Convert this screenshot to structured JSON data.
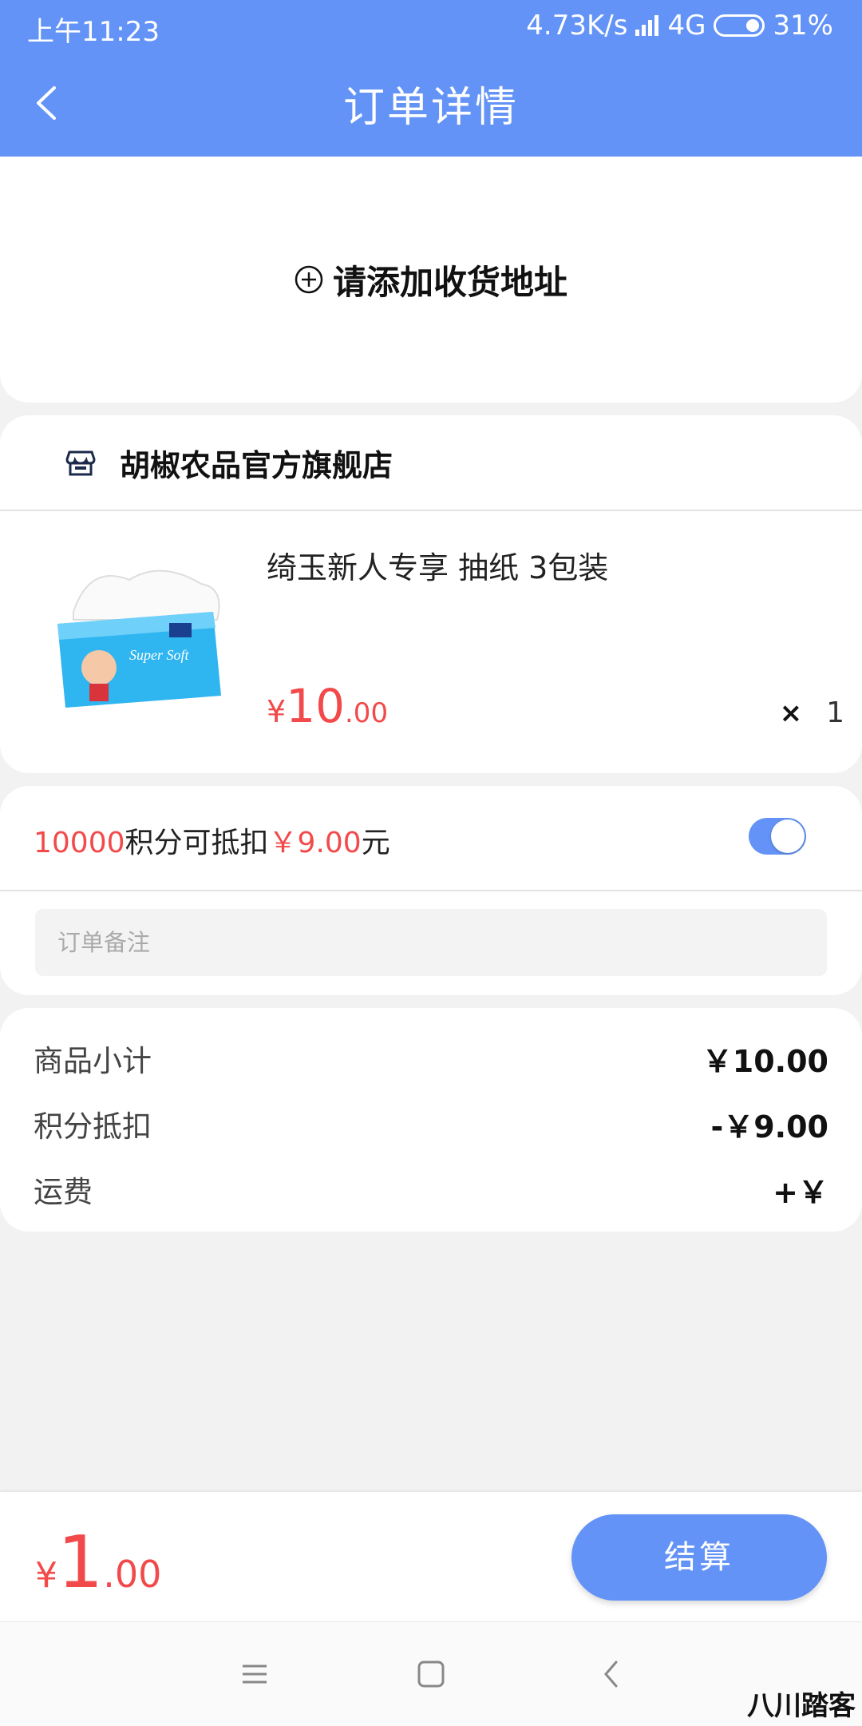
{
  "status_bar": {
    "time": "上午11:23",
    "speed": "4.73K/s",
    "network": "4G",
    "battery": "31%"
  },
  "header": {
    "title": "订单详情",
    "back_icon": "chevron-left-icon"
  },
  "address": {
    "add_label": "请添加收货地址",
    "icon": "plus-circle-icon"
  },
  "shop": {
    "name": "胡椒农品官方旗舰店",
    "icon": "shop-icon"
  },
  "goods": {
    "title": "绮玉新人专享 抽纸 3包装",
    "currency": "¥",
    "price_int": "10",
    "price_dec": ".00",
    "qty_mark": "×",
    "qty": "1"
  },
  "points": {
    "amount": "10000",
    "text1": "积分可抵扣",
    "deduct": "￥9.00",
    "text2": "元",
    "toggle_on": true
  },
  "remark": {
    "placeholder": "订单备注"
  },
  "summary": [
    {
      "label": "商品小计",
      "value": "￥10.00"
    },
    {
      "label": "积分抵扣",
      "value": "-￥9.00"
    },
    {
      "label": "运费",
      "value": "+￥"
    }
  ],
  "footer": {
    "currency": "¥",
    "total_int": "1",
    "total_dec": ".00",
    "pay_label": "结算"
  },
  "watermark": "八川踏客",
  "colors": {
    "accent": "#6393f6",
    "price_red": "#f24a4a"
  }
}
